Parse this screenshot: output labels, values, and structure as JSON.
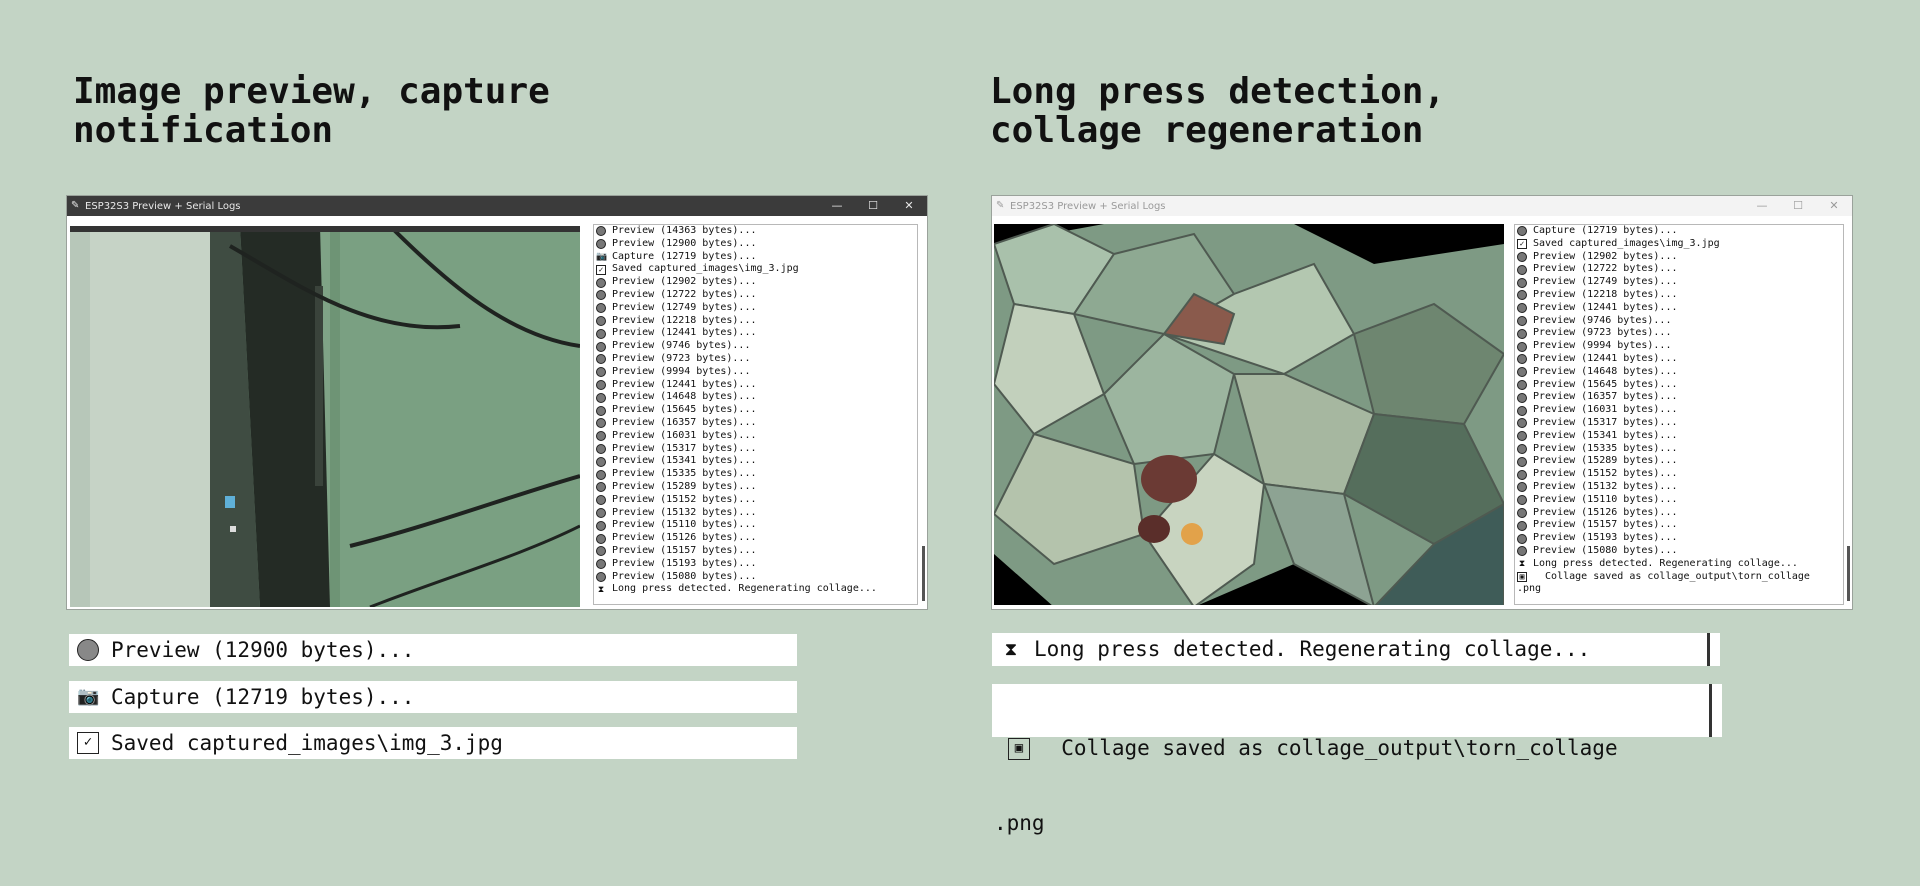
{
  "left": {
    "heading_line1": "Image preview, capture",
    "heading_line2": "notification",
    "window_title": "ESP32S3 Preview + Serial Logs",
    "log": [
      {
        "icon": "circle",
        "text": "Preview (14363 bytes)..."
      },
      {
        "icon": "circle",
        "text": "Preview (12900 bytes)..."
      },
      {
        "icon": "camera",
        "text": "Capture (12719 bytes)..."
      },
      {
        "icon": "check",
        "text": "Saved captured_images\\img_3.jpg"
      },
      {
        "icon": "circle",
        "text": "Preview (12902 bytes)..."
      },
      {
        "icon": "circle",
        "text": "Preview (12722 bytes)..."
      },
      {
        "icon": "circle",
        "text": "Preview (12749 bytes)..."
      },
      {
        "icon": "circle",
        "text": "Preview (12218 bytes)..."
      },
      {
        "icon": "circle",
        "text": "Preview (12441 bytes)..."
      },
      {
        "icon": "circle",
        "text": "Preview (9746 bytes)..."
      },
      {
        "icon": "circle",
        "text": "Preview (9723 bytes)..."
      },
      {
        "icon": "circle",
        "text": "Preview (9994 bytes)..."
      },
      {
        "icon": "circle",
        "text": "Preview (12441 bytes)..."
      },
      {
        "icon": "circle",
        "text": "Preview (14648 bytes)..."
      },
      {
        "icon": "circle",
        "text": "Preview (15645 bytes)..."
      },
      {
        "icon": "circle",
        "text": "Preview (16357 bytes)..."
      },
      {
        "icon": "circle",
        "text": "Preview (16031 bytes)..."
      },
      {
        "icon": "circle",
        "text": "Preview (15317 bytes)..."
      },
      {
        "icon": "circle",
        "text": "Preview (15341 bytes)..."
      },
      {
        "icon": "circle",
        "text": "Preview (15335 bytes)..."
      },
      {
        "icon": "circle",
        "text": "Preview (15289 bytes)..."
      },
      {
        "icon": "circle",
        "text": "Preview (15152 bytes)..."
      },
      {
        "icon": "circle",
        "text": "Preview (15132 bytes)..."
      },
      {
        "icon": "circle",
        "text": "Preview (15110 bytes)..."
      },
      {
        "icon": "circle",
        "text": "Preview (15126 bytes)..."
      },
      {
        "icon": "circle",
        "text": "Preview (15157 bytes)..."
      },
      {
        "icon": "circle",
        "text": "Preview (15193 bytes)..."
      },
      {
        "icon": "circle",
        "text": "Preview (15080 bytes)..."
      },
      {
        "icon": "hourglass",
        "text": "Long press detected. Regenerating collage..."
      }
    ],
    "callouts": [
      {
        "icon": "circle",
        "text": "Preview (12900 bytes)..."
      },
      {
        "icon": "camera",
        "text": "Capture (12719 bytes)..."
      },
      {
        "icon": "check",
        "text": "Saved captured_images\\img_3.jpg"
      }
    ]
  },
  "right": {
    "heading_line1": "Long press detection,",
    "heading_line2": "collage regeneration",
    "window_title": "ESP32S3 Preview + Serial Logs",
    "log": [
      {
        "icon": "circle",
        "text": "Capture (12719 bytes)..."
      },
      {
        "icon": "check",
        "text": "Saved captured_images\\img_3.jpg"
      },
      {
        "icon": "circle",
        "text": "Preview (12902 bytes)..."
      },
      {
        "icon": "circle",
        "text": "Preview (12722 bytes)..."
      },
      {
        "icon": "circle",
        "text": "Preview (12749 bytes)..."
      },
      {
        "icon": "circle",
        "text": "Preview (12218 bytes)..."
      },
      {
        "icon": "circle",
        "text": "Preview (12441 bytes)..."
      },
      {
        "icon": "circle",
        "text": "Preview (9746 bytes)..."
      },
      {
        "icon": "circle",
        "text": "Preview (9723 bytes)..."
      },
      {
        "icon": "circle",
        "text": "Preview (9994 bytes)..."
      },
      {
        "icon": "circle",
        "text": "Preview (12441 bytes)..."
      },
      {
        "icon": "circle",
        "text": "Preview (14648 bytes)..."
      },
      {
        "icon": "circle",
        "text": "Preview (15645 bytes)..."
      },
      {
        "icon": "circle",
        "text": "Preview (16357 bytes)..."
      },
      {
        "icon": "circle",
        "text": "Preview (16031 bytes)..."
      },
      {
        "icon": "circle",
        "text": "Preview (15317 bytes)..."
      },
      {
        "icon": "circle",
        "text": "Preview (15341 bytes)..."
      },
      {
        "icon": "circle",
        "text": "Preview (15335 bytes)..."
      },
      {
        "icon": "circle",
        "text": "Preview (15289 bytes)..."
      },
      {
        "icon": "circle",
        "text": "Preview (15152 bytes)..."
      },
      {
        "icon": "circle",
        "text": "Preview (15132 bytes)..."
      },
      {
        "icon": "circle",
        "text": "Preview (15110 bytes)..."
      },
      {
        "icon": "circle",
        "text": "Preview (15126 bytes)..."
      },
      {
        "icon": "circle",
        "text": "Preview (15157 bytes)..."
      },
      {
        "icon": "circle",
        "text": "Preview (15193 bytes)..."
      },
      {
        "icon": "circle",
        "text": "Preview (15080 bytes)..."
      },
      {
        "icon": "hourglass",
        "text": "Long press detected. Regenerating collage..."
      },
      {
        "icon": "picture",
        "text": "  Collage saved as collage_output\\torn_collage"
      },
      {
        "icon": "none",
        "text": ".png"
      }
    ],
    "callouts": [
      {
        "icon": "hourglass",
        "text": "Long press detected. Regenerating collage..."
      },
      {
        "icon": "picture",
        "text": "  Collage saved as collage_output\\torn_collage",
        "text2": ".png"
      }
    ]
  },
  "window_controls": {
    "minimize": "—",
    "maximize": "☐",
    "close": "✕"
  },
  "colors": {
    "background": "#c3d4c5",
    "left_titlebar": "#3b3b3b",
    "right_titlebar": "#f3f3f3"
  }
}
